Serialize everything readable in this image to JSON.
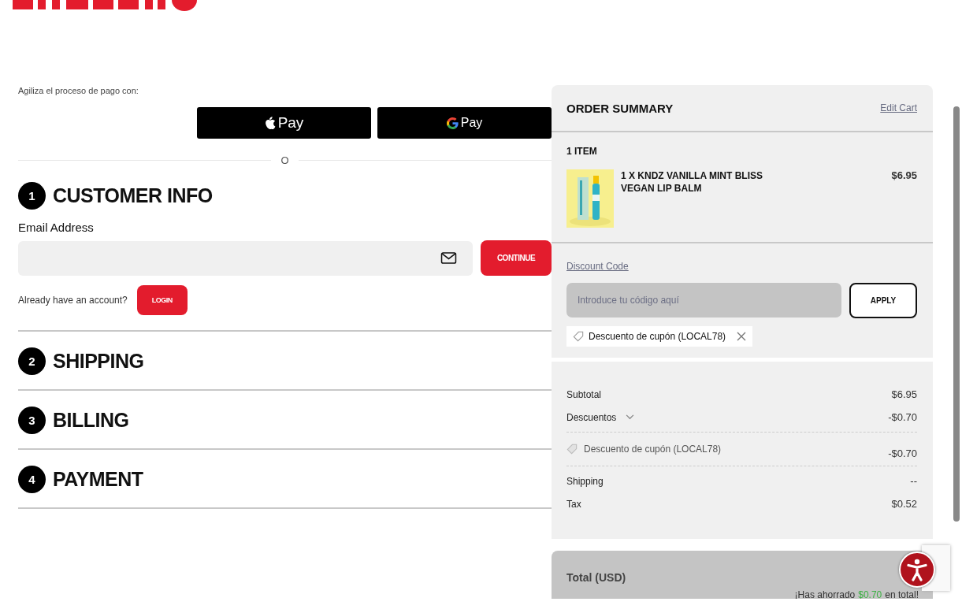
{
  "express_checkout": {
    "label": "Agiliza el proceso de pago con:",
    "wallets": [
      {
        "kind": "apple",
        "label": "Pay"
      },
      {
        "kind": "google",
        "label": "Pay"
      }
    ],
    "divider": "O"
  },
  "steps": [
    {
      "number": "1",
      "title": "CUSTOMER INFO",
      "form": {
        "email_label": "Email Address",
        "continue": "CONTINUE",
        "account_prompt": "Already have an account?",
        "login": "LOGIN"
      }
    },
    {
      "number": "2",
      "title": "SHIPPING"
    },
    {
      "number": "3",
      "title": "BILLING"
    },
    {
      "number": "4",
      "title": "PAYMENT"
    }
  ],
  "order_summary": {
    "title": "ORDER SUMMARY",
    "edit_link": "Edit Cart",
    "item_count": "1 ITEM",
    "items": [
      {
        "name": "1 X KNDZ VANILLA MINT BLISS VEGAN LIP BALM",
        "price": "$6.95"
      }
    ],
    "discount": {
      "link": "Discount Code",
      "placeholder": "Introduce tu código aquí",
      "apply": "APPLY",
      "applied": "Descuento de cupón (LOCAL78)"
    },
    "totals": [
      {
        "kind": "row",
        "label": "Subtotal",
        "value": "$6.95"
      },
      {
        "kind": "expandable",
        "label": "Descuentos",
        "value": "-$0.70",
        "expanded": true
      },
      {
        "kind": "coupon",
        "label": "Descuento de cupón (LOCAL78)",
        "value": "-$0.70"
      },
      {
        "kind": "row",
        "label": "Shipping",
        "value": "--"
      },
      {
        "kind": "row",
        "label": "Tax",
        "value": "$0.52"
      }
    ],
    "total": {
      "label": "Total (USD)",
      "savings_prefix": "¡Has ahorrado",
      "savings_amount": "$0.70",
      "savings_suffix": "en total!"
    }
  }
}
